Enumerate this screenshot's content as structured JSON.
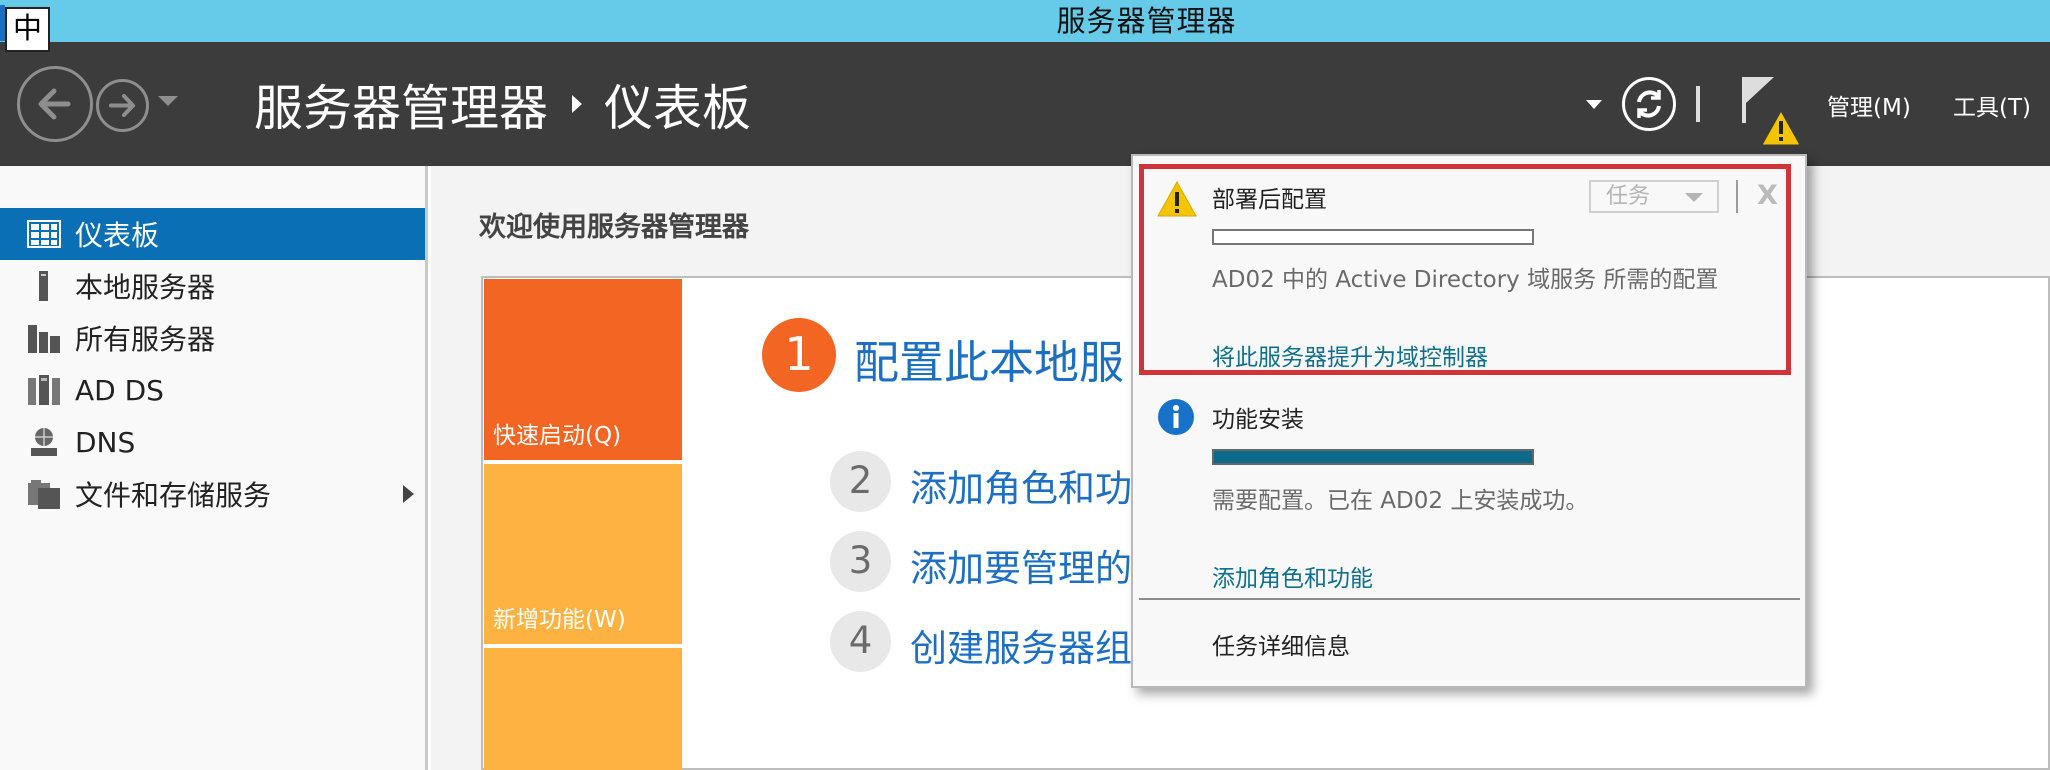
{
  "window": {
    "title": "服务器管理器"
  },
  "ime": {
    "label": "中"
  },
  "header": {
    "breadcrumb_root": "服务器管理器",
    "breadcrumb_current": "仪表板",
    "menu_manage": "管理(M)",
    "menu_tools": "工具(T)"
  },
  "sidebar": {
    "items": [
      {
        "label": "仪表板",
        "icon": "dashboard-icon",
        "active": true
      },
      {
        "label": "本地服务器",
        "icon": "server-icon"
      },
      {
        "label": "所有服务器",
        "icon": "servers-icon"
      },
      {
        "label": "AD DS",
        "icon": "ad-ds-icon"
      },
      {
        "label": "DNS",
        "icon": "dns-icon"
      },
      {
        "label": "文件和存储服务",
        "icon": "file-storage-icon",
        "expandable": true
      }
    ]
  },
  "main": {
    "welcome_title": "欢迎使用服务器管理器",
    "tiles": {
      "quick_start": "快速启动(Q)",
      "new_features": "新增功能(W)"
    },
    "steps": [
      {
        "number": "1",
        "text": "配置此本地服"
      },
      {
        "number": "2",
        "text": "添加角色和功"
      },
      {
        "number": "3",
        "text": "添加要管理的"
      },
      {
        "number": "4",
        "text": "创建服务器组"
      }
    ]
  },
  "notifications": {
    "items": [
      {
        "icon": "warning-icon",
        "title": "部署后配置",
        "progress": 0,
        "message": "AD02 中的 Active Directory 域服务 所需的配置",
        "link": "将此服务器提升为域控制器",
        "task_dropdown": "任务",
        "dismiss": "X"
      },
      {
        "icon": "info-icon",
        "title": "功能安装",
        "progress": 1.0,
        "message": "需要配置。已在 AD02 上安装成功。",
        "link": "添加角色和功能"
      }
    ],
    "task_details": "任务详细信息"
  },
  "colors": {
    "title_bar": "#66cbe8",
    "header": "#3c3c3c",
    "nav_active": "#0b6fb5",
    "tile_orange": "#f26522",
    "tile_yellow": "#fdb241",
    "link": "#0f6f8f",
    "highlight_border": "#d13438"
  }
}
